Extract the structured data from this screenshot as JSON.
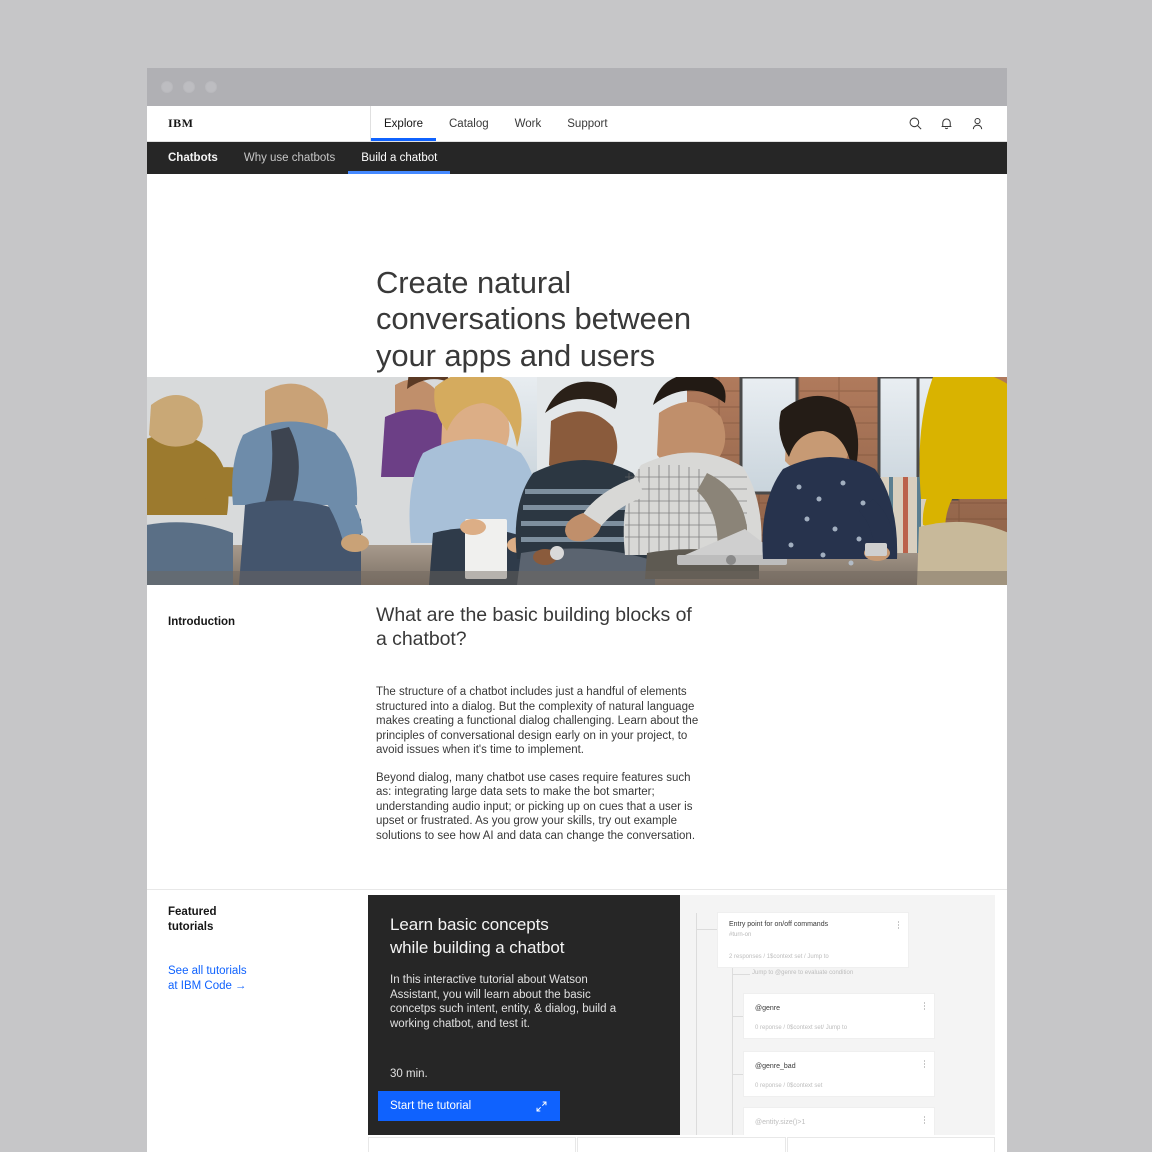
{
  "window": {
    "chrome_dots": [
      "close",
      "minimize",
      "maximize"
    ]
  },
  "masthead": {
    "logo": "IBM",
    "nav": [
      {
        "label": "Explore",
        "active": true
      },
      {
        "label": "Catalog",
        "active": false
      },
      {
        "label": "Work",
        "active": false
      },
      {
        "label": "Support",
        "active": false
      }
    ],
    "icons": [
      "search-icon",
      "notification-bell-icon",
      "user-avatar-icon"
    ]
  },
  "subnav": {
    "brand": "Chatbots",
    "items": [
      {
        "label": "Why use chatbots",
        "active": false
      },
      {
        "label": "Build a chatbot",
        "active": true
      }
    ]
  },
  "hero": {
    "title": "Create natural conversations between your apps and users"
  },
  "hero_photo": {
    "alt": "Group of colleagues seated together in a brick-walled loft office, talking and looking at a laptop"
  },
  "intro": {
    "eyebrow": "Introduction",
    "heading": "What are the basic building blocks of a chatbot?",
    "paragraph1": "The structure of a chatbot includes just a handful of elements structured into a dialog.  But the complexity of natural language makes creating a functional dialog challenging.  Learn about the principles of conversational design early on in your project, to avoid issues when it's time to implement.",
    "paragraph2": "Beyond dialog, many chatbot use cases require features such as: integrating large data sets to make the bot smarter; understanding audio input; or picking up on cues that a user is upset or frustrated. As you grow your skills, try out example solutions to see how AI and data can change the conversation."
  },
  "featured": {
    "eyebrow_line1": "Featured",
    "eyebrow_line2": "tutorials",
    "see_all_line1": "See all tutorials",
    "see_all_line2": "at IBM Code",
    "see_all_arrow": "→",
    "card": {
      "title_line1": "Learn basic concepts",
      "title_line2": "while building a chatbot",
      "description": "In this interactive tutorial about Watson Assistant, you will learn about the basic concetps such intent, entity, & dialog, build a working chatbot, and test it.",
      "duration": "30 min.",
      "button_label": "Start the tutorial",
      "button_icon": "launch-expand-icon",
      "button_color": "#0f62fe",
      "background": "#262626"
    }
  },
  "dialog_preview": {
    "nodes": [
      {
        "title": "Entry point for on/off commands",
        "sub": "#turn-on",
        "meta": "2 responses / 1$context set / Jump to"
      },
      {
        "title": "@genre",
        "sub": "",
        "meta": "0 reponse / 0$context set/ Jump to"
      },
      {
        "title": "@genre_bad",
        "sub": "",
        "meta": "0 reponse / 0$context set"
      },
      {
        "title": "@entity.size()>1",
        "sub": "",
        "meta": ""
      }
    ],
    "connector_label": "Jump to @genre to evaluate condition"
  },
  "bottom_strip": {
    "cards": [
      "card-1",
      "card-2",
      "card-3"
    ]
  },
  "colors": {
    "accent": "#0f62fe",
    "accent_light": "#4589ff",
    "dark": "#262626",
    "text": "#393939",
    "chrome": "#b0b0b4",
    "page_bg": "#c6c6c8"
  }
}
